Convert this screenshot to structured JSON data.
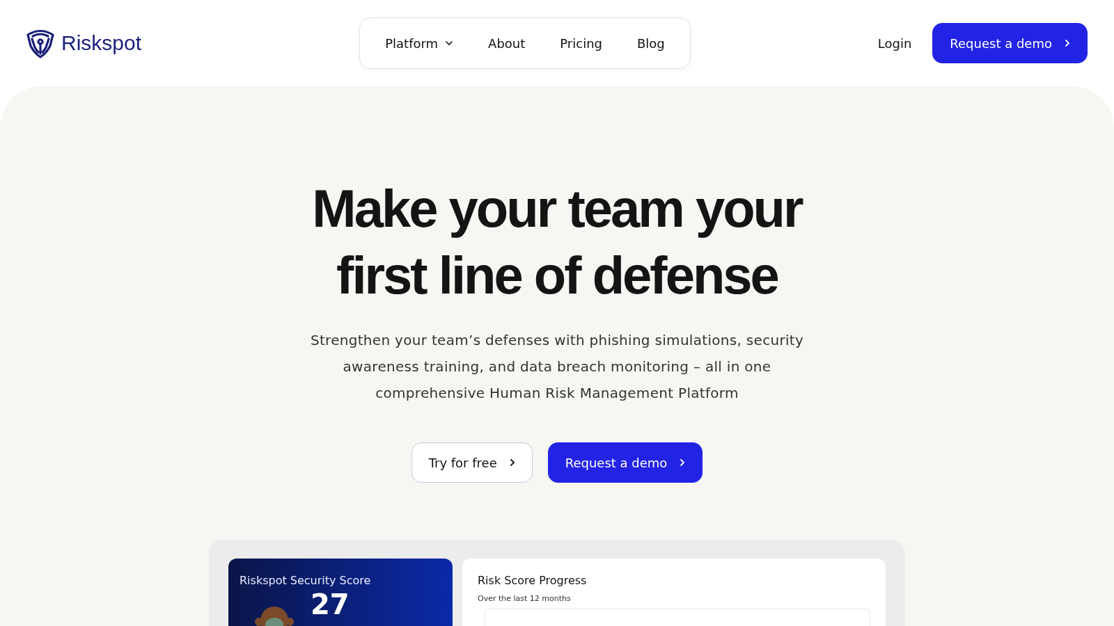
{
  "brand": {
    "name": "Riskspot"
  },
  "nav": {
    "items": [
      {
        "label": "Platform",
        "has_menu": true
      },
      {
        "label": "About",
        "has_menu": false
      },
      {
        "label": "Pricing",
        "has_menu": false
      },
      {
        "label": "Blog",
        "has_menu": false
      }
    ],
    "login": "Login",
    "cta": "Request a demo"
  },
  "hero": {
    "title_lines": [
      "Make your team your",
      "first line of defense"
    ],
    "subtitle": "Strengthen your team’s defenses with phishing simulations, security awareness training, and data breach monitoring – all in one comprehensive Human Risk Management Platform",
    "buttons": [
      {
        "label": "Try for free",
        "kind": "secondary"
      },
      {
        "label": "Request a demo",
        "kind": "primary"
      }
    ]
  },
  "dashboard": {
    "score_card": {
      "title": "Riskspot Security Score",
      "score": "27"
    },
    "progress_card": {
      "title": "Risk Score Progress",
      "subtitle": "Over the last 12 months"
    }
  }
}
